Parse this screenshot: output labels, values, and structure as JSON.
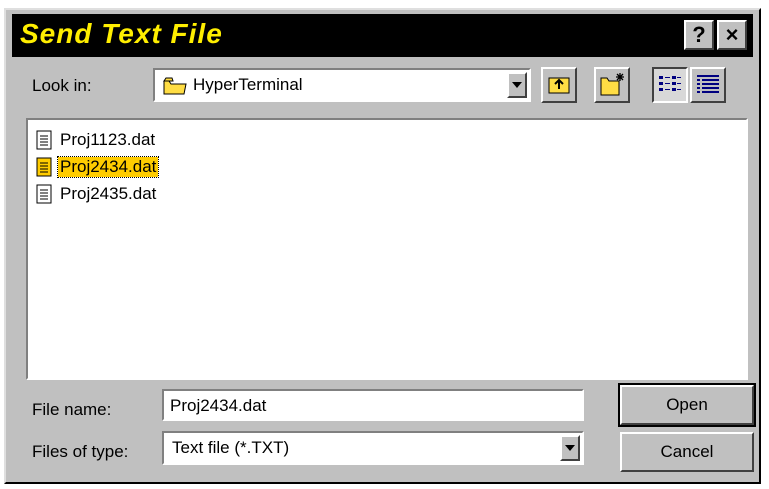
{
  "window": {
    "title": "Send Text File",
    "help_label": "?",
    "close_label": "×"
  },
  "look_in": {
    "label": "Look in:",
    "value": "HyperTerminal"
  },
  "toolbar": {
    "icons": [
      "up-one-level-icon",
      "create-new-folder-icon",
      "list-view-icon",
      "details-view-icon"
    ]
  },
  "files": [
    {
      "name": "Proj1123.dat",
      "selected": false
    },
    {
      "name": "Proj2434.dat",
      "selected": true
    },
    {
      "name": "Proj2435.dat",
      "selected": false
    }
  ],
  "file_name": {
    "label": "File name:",
    "value": "Proj2434.dat"
  },
  "file_type": {
    "label": "Files of type:",
    "value": "Text file (*.TXT)"
  },
  "buttons": {
    "open": "Open",
    "cancel": "Cancel"
  },
  "colors": {
    "title_bar": "#000000",
    "title_text": "#ffee00",
    "selection": "#ffcc00",
    "face": "#c0c0c0"
  }
}
